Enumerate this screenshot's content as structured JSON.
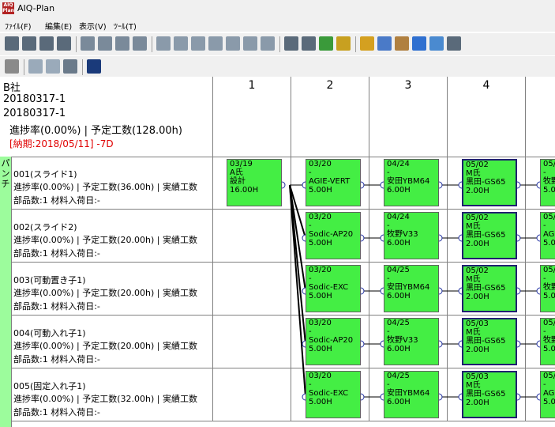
{
  "window": {
    "title": "AIQ-Plan",
    "icon_text": "AIQ Plan"
  },
  "menu": [
    {
      "label": "ﾌｧｲﾙ(F)"
    },
    {
      "label": "編集(E)"
    },
    {
      "label": "表示(V)"
    },
    {
      "label": "ﾂｰﾙ(T)"
    }
  ],
  "info": {
    "company": "B社",
    "order1": "20180317-1",
    "order2": "20180317-1",
    "progress": "進捗率(0.00%) | 予定工数(128.00h)",
    "deadline": "[納期:2018/05/11] -7D"
  },
  "columns": [
    "1",
    "2",
    "3",
    "4"
  ],
  "group_label": "パンチ",
  "rows": [
    {
      "name": "001(スライド1)",
      "stats": "進捗率(0.00%) | 予定工数(36.00h) | 実績工数",
      "parts": "部品数:1  材料入荷日:-"
    },
    {
      "name": "002(スライド2)",
      "stats": "進捗率(0.00%) | 予定工数(20.00h) | 実績工数",
      "parts": "部品数:1  材料入荷日:-"
    },
    {
      "name": "003(可動置き子1)",
      "stats": "進捗率(0.00%) | 予定工数(20.00h) | 実績工数",
      "parts": "部品数:1  材料入荷日:-"
    },
    {
      "name": "004(可動入れ子1)",
      "stats": "進捗率(0.00%) | 予定工数(20.00h) | 実績工数",
      "parts": "部品数:1  材料入荷日:-"
    },
    {
      "name": "005(固定入れ子1)",
      "stats": "進捗率(0.00%) | 予定工数(32.00h) | 実績工数",
      "parts": "部品数:1  材料入荷日:-"
    }
  ],
  "tasks": [
    [
      {
        "col": 0,
        "lines": [
          "03/19",
          "A氏",
          "設計",
          "16.00H"
        ]
      },
      {
        "col": 1,
        "lines": [
          "03/20",
          "-",
          "AGIE-VERT",
          "5.00H"
        ]
      },
      {
        "col": 2,
        "lines": [
          "04/24",
          "-",
          "安田YBM64",
          "6.00H"
        ]
      },
      {
        "col": 3,
        "lines": [
          "05/02",
          "M氏",
          "黒田-GS65",
          "2.00H"
        ],
        "sel": true
      },
      {
        "col": 4,
        "lines": [
          "05/",
          "-",
          "牧野",
          "5.0"
        ]
      }
    ],
    [
      {
        "col": 1,
        "lines": [
          "03/20",
          "-",
          "Sodic-AP20",
          "5.00H"
        ]
      },
      {
        "col": 2,
        "lines": [
          "04/24",
          "-",
          "牧野V33",
          "6.00H"
        ]
      },
      {
        "col": 3,
        "lines": [
          "05/02",
          "M氏",
          "黒田-GS65",
          "2.00H"
        ],
        "sel": true
      },
      {
        "col": 4,
        "lines": [
          "05/",
          "-",
          "AG",
          "5.0"
        ]
      }
    ],
    [
      {
        "col": 1,
        "lines": [
          "03/20",
          "-",
          "Sodic-EXC",
          "5.00H"
        ]
      },
      {
        "col": 2,
        "lines": [
          "04/25",
          "-",
          "安田YBM64",
          "6.00H"
        ]
      },
      {
        "col": 3,
        "lines": [
          "05/02",
          "M氏",
          "黒田-GS65",
          "2.00H"
        ],
        "sel": true
      },
      {
        "col": 4,
        "lines": [
          "05/",
          "-",
          "牧野",
          "5.0"
        ]
      }
    ],
    [
      {
        "col": 1,
        "lines": [
          "03/20",
          "-",
          "Sodic-AP20",
          "5.00H"
        ]
      },
      {
        "col": 2,
        "lines": [
          "04/25",
          "-",
          "牧野V33",
          "6.00H"
        ]
      },
      {
        "col": 3,
        "lines": [
          "05/03",
          "M氏",
          "黒田-GS65",
          "2.00H"
        ],
        "sel": true
      },
      {
        "col": 4,
        "lines": [
          "05/",
          "-",
          "牧野",
          "5.0"
        ]
      }
    ],
    [
      {
        "col": 1,
        "lines": [
          "03/20",
          "-",
          "Sodic-EXC",
          "5.00H"
        ]
      },
      {
        "col": 2,
        "lines": [
          "04/25",
          "-",
          "安田YBM64",
          "6.00H"
        ]
      },
      {
        "col": 3,
        "lines": [
          "05/03",
          "M氏",
          "黒田-GS65",
          "2.00H"
        ],
        "sel": true
      },
      {
        "col": 4,
        "lines": [
          "05/",
          "-",
          "AG",
          "5.0"
        ]
      }
    ]
  ],
  "colors": {
    "task_fill": "#44ee44",
    "deadline": "#e00000",
    "group_fill": "#9cfc9c",
    "selected_border": "#202070"
  }
}
